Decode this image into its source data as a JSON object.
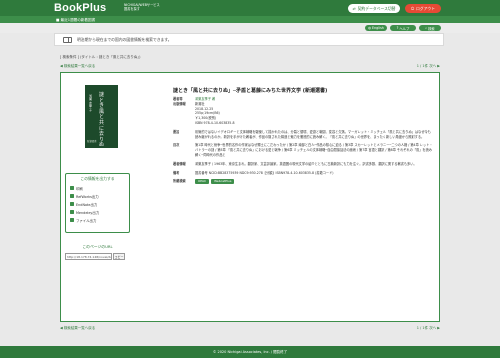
{
  "header": {
    "logo": "BookPlus",
    "logo_sub_line1": "NICHIGAI/WEBサービス",
    "logo_sub_line2": "図書を探す",
    "btn_service": "契約データベース切替",
    "btn_logout": "ログアウト"
  },
  "subbar": {
    "text": "■ 最近1週間の新着図書"
  },
  "langbar": {
    "english": "English",
    "help": "ヘルプ",
    "search_link": "検索"
  },
  "notice": {
    "text": "明治期から現在までの国内の図書情報を検索できます。"
  },
  "search_info": "[ 検索条件 ] (タイトル : 謎とき「風と共に去りぬ」)",
  "nav": {
    "back": "検索結果一覧へ戻る",
    "pager": "1 / 1件  次へ ▶"
  },
  "book": {
    "title": "謎とき「風と共に去りぬ」─矛盾と葛藤にみちた世界文学 (新潮選書)",
    "cover_title": "謎とき風と共に去りぬ",
    "cover_author": "鴻巣友季子",
    "cover_publisher": "新潮選書"
  },
  "meta": [
    {
      "label": "著者等",
      "value": "鴻巣友季子 著",
      "link": true
    },
    {
      "label": "出版情報",
      "value": "新潮社"
    },
    {
      "label": "",
      "value": "2018.12.25"
    },
    {
      "label": "",
      "value": "255p;19cm(B6)"
    },
    {
      "label": "",
      "value": "￥1,300(税別)"
    },
    {
      "label": "",
      "value": "ISBN 978-4-10-603835-8"
    },
    {
      "label": "要旨",
      "value": "彩管的ではないイデオロギーと文体戦略を駆使して描かれたのは、分裂と循環、愛欲と戦闘、変容と欠落。マーガレット・ミッチェル「風と共に去りぬ」はなぜ今も読み継がれるのか。新訳を手がけた著者が、作品の隠された構造と魅力を徹底的に読み解く。「風と共に去りぬ」の世界を、まったく新しい角度から照射する。"
    },
    {
      "label": "目次",
      "value": "第1章 時代と紛争─世界的名作の作家はなぜ郷土にこだわったか / 第2章 南部と白人─作品の核心に迫る / 第3章 スカーレットとメラニー─二つの人格 / 第4章 レット・バトラーの謎 / 第5章 「風と共に去りぬ」における愛と戦争 / 第6章 ミッチェルの文体戦略─自由間接話法の魔術 / 第7章 言語と翻訳 / 第8章 それぞれの「風」を読み解く─同時代の作品と"
    },
    {
      "label": "著者情報",
      "value": "鴻巣友季子 / 1963年、東京生まれ。翻訳家、文芸評論家。英語圏の現代文学の紹介とともに古典新訳にも力を注ぐ。訳書多数、翻訳に関する著書も多い。"
    },
    {
      "label": "備考",
      "value": "図書番号 NCID:BB28375939 NDC9:930.278【分類】ISBN978-4-10-603835-8 (書籍コード)"
    },
    {
      "label": "所蔵検索",
      "value": "",
      "badges": [
        "OPAC",
        "WebcatPlus"
      ]
    }
  ],
  "side": {
    "box_title": "この情報を出力する",
    "items": [
      "印刷",
      "RefWorks出力",
      "EndNote出力",
      "Mendeley出力",
      "ファイル出力"
    ],
    "url_title": "このページのURL",
    "url_value": "http://18.178.74.148/novel/detail?",
    "url_copy": "コピー"
  },
  "footer": {
    "text": "© 2020 Nichigai Associates, Inc. / 閲覧終了"
  },
  "colors": {
    "brand": "#2f7a3c",
    "accent_red": "#e64a35"
  }
}
